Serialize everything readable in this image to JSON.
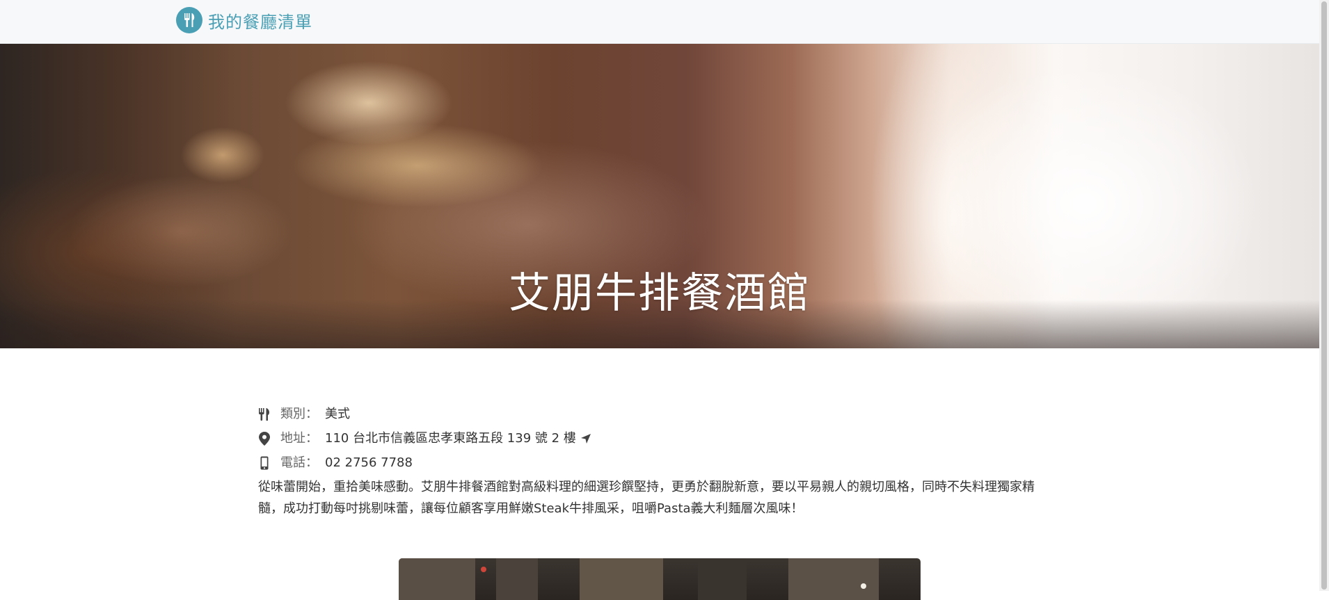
{
  "navbar": {
    "brand_text": "我的餐廳清單",
    "brand_icon": "utensils-icon",
    "brand_color": "#4a9fb5"
  },
  "hero": {
    "title": "艾朋牛排餐酒館"
  },
  "info": {
    "category": {
      "icon": "utensils-icon",
      "label": "類別：",
      "value": "美式"
    },
    "address": {
      "icon": "map-marker-icon",
      "label": "地址：",
      "value": "110 台北市信義區忠孝東路五段 139 號 2 樓",
      "action_icon": "location-arrow-icon"
    },
    "phone": {
      "icon": "mobile-phone-icon",
      "label": "電話：",
      "value": "02 2756 7788"
    },
    "description": "從味蕾開始，重拾美味感動。艾朋牛排餐酒館對高級料理的細選珍饌堅持，更勇於翻脫新意，要以平易親人的親切風格，同時不失料理獨家精髓，成功打動每吋挑剔味蕾，讓每位顧客享用鮮嫩Steak牛排風采，咀嚼Pasta義大利麵層次風味！"
  }
}
